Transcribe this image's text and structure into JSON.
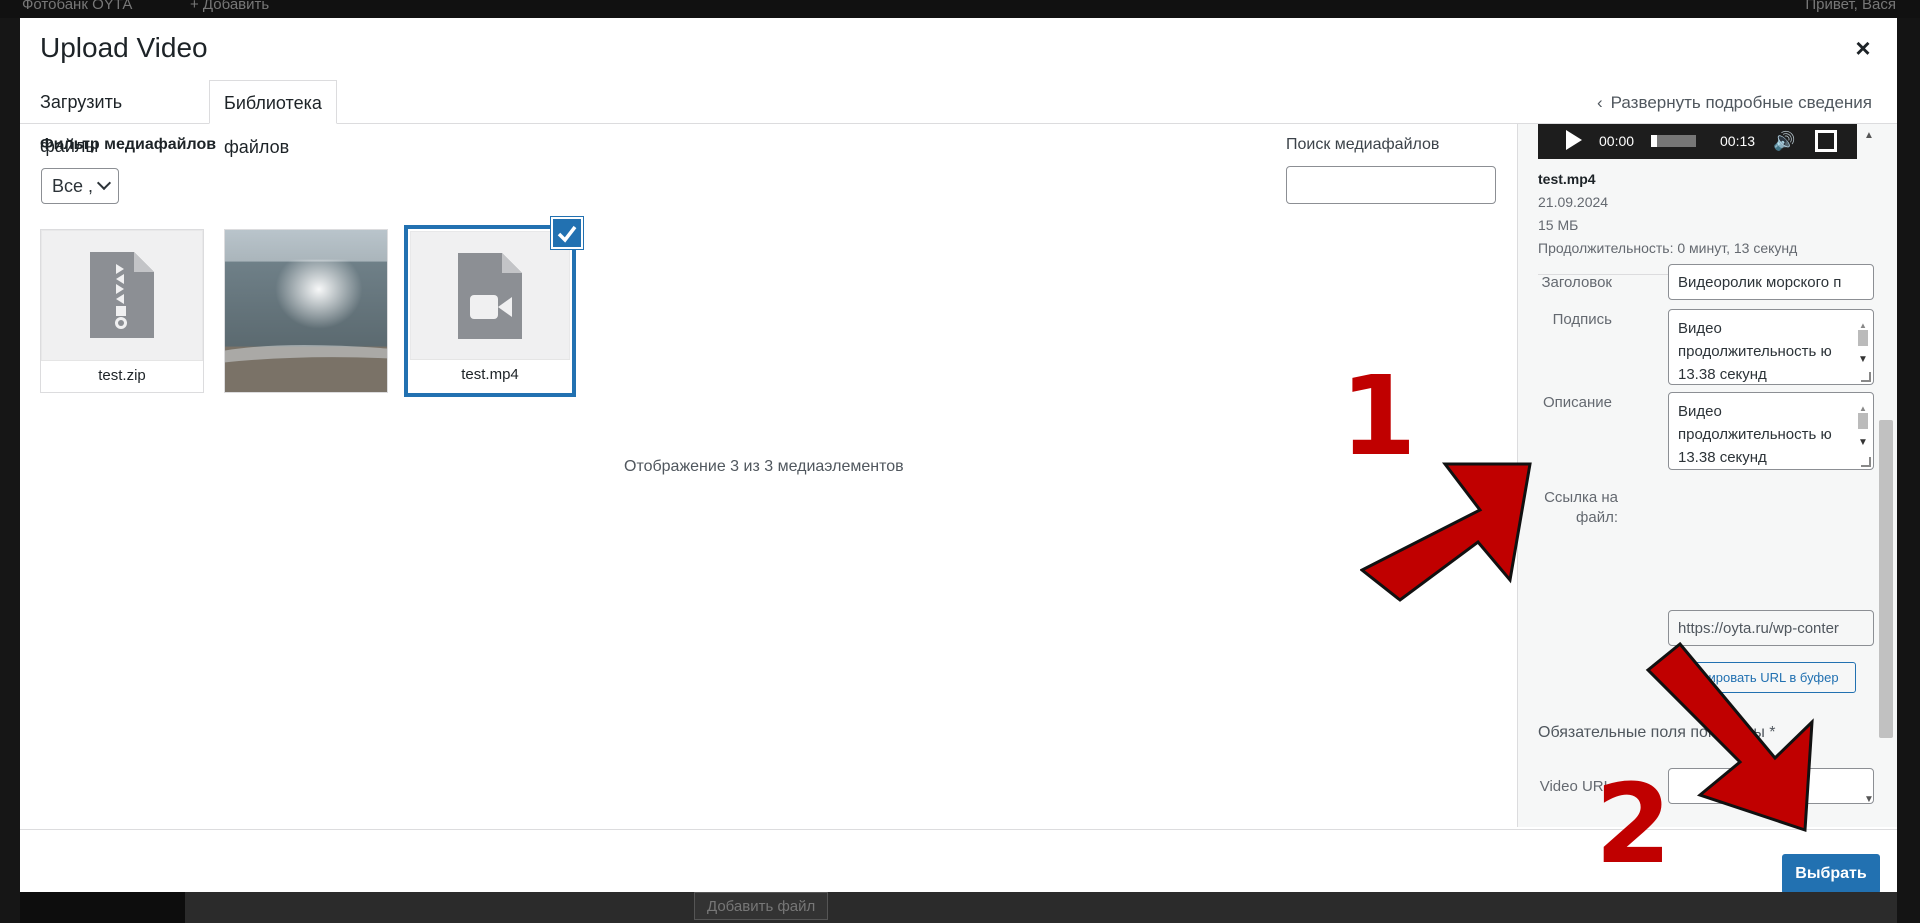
{
  "background": {
    "topbar_left": "Фотобанк ОYТА",
    "topbar_add": "+ Добавить",
    "topbar_right": "Привет, Вася",
    "bottom_button": "Добавить файл"
  },
  "modal": {
    "title": "Upload Video",
    "close_label": "×",
    "tabs": [
      {
        "label": "Загрузить файлы",
        "active": false
      },
      {
        "label": "Библиотека файлов",
        "active": true
      }
    ],
    "expand_details": "Развернуть подробные сведения"
  },
  "browser": {
    "filter_label": "Фильтр медиафайлов",
    "filter_selected": "Все ,",
    "search_label": "Поиск медиафайлов",
    "search_value": "",
    "attachments": [
      {
        "name": "test.zip",
        "type": "archive",
        "selected": false
      },
      {
        "name": "",
        "type": "image",
        "selected": false
      },
      {
        "name": "test.mp4",
        "type": "video",
        "selected": true
      }
    ],
    "count_text": "Отображение 3 из 3 медиаэлементов"
  },
  "details": {
    "player": {
      "current_time": "00:00",
      "duration": "00:13",
      "progress": 0.0
    },
    "filename": "test.mp4",
    "date": "21.09.2024",
    "size": "15 МБ",
    "duration_text": "Продолжительность: 0 минут, 13 секунд",
    "fields": {
      "title_label": "Заголовок",
      "title_value": "Видеоролик морского п",
      "caption_label": "Подпись",
      "caption_value": "Видео продолжительность ю 13.38 секунд",
      "description_label": "Описание",
      "description_value": "Видео продолжительность ю 13.38 секунд",
      "file_url_label": "Ссылка на файл:",
      "file_url_value": "https://oyta.ru/wp-conter",
      "copy_button": "Скопировать URL в буфер",
      "required_text": "Обязательные поля помечены *",
      "video_url_label": "Video URL",
      "video_url_value": ""
    }
  },
  "footer": {
    "select_button": "Выбрать"
  },
  "annotations": {
    "step1": "1",
    "step2": "2",
    "arrow_color": "#c00000"
  },
  "colors": {
    "accent": "#2271b1",
    "arrow": "#c00000"
  }
}
